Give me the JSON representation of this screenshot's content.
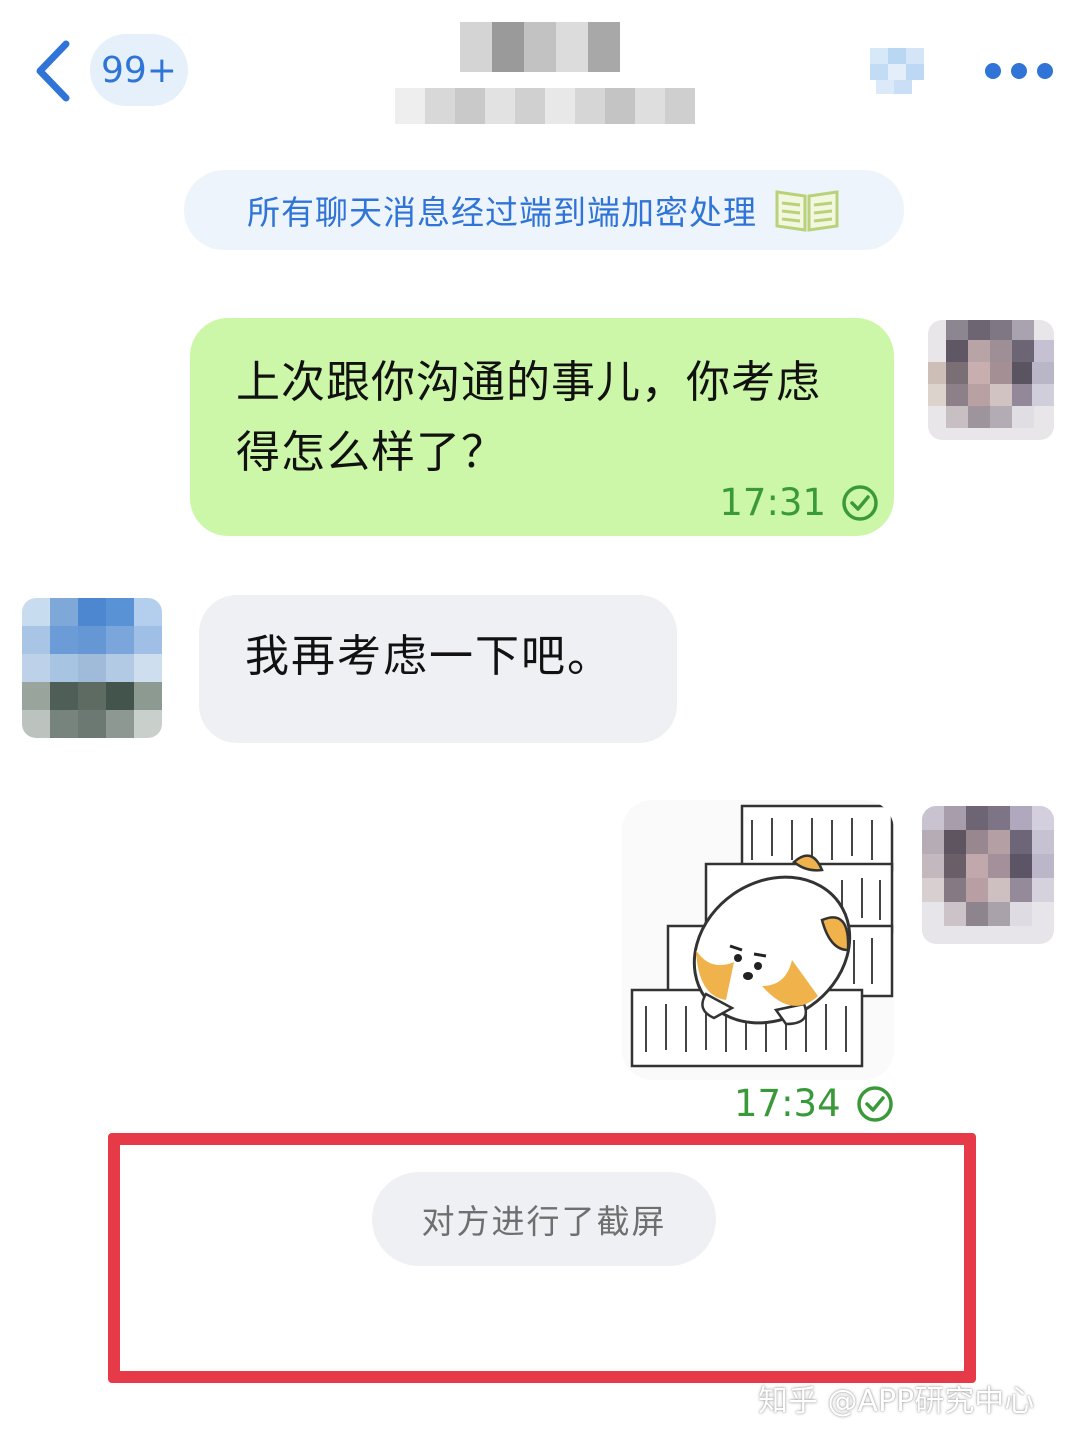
{
  "header": {
    "unread_badge": "99+",
    "back_icon": "chevron-left-icon",
    "call_icon": "phone-icon",
    "more_icon": "more-dots-icon",
    "accent_color": "#2f74d6"
  },
  "notice": {
    "encryption_text": "所有聊天消息经过端到端加密处理",
    "icon": "book-icon"
  },
  "messages": [
    {
      "direction": "outgoing",
      "text": "上次跟你沟通的事儿，你考虑得怎么样了？",
      "time": "17:31",
      "status_icon": "check-circle-icon",
      "bubble_color": "#cdf7a8"
    },
    {
      "direction": "incoming",
      "text": "我再考虑一下吧。",
      "bubble_color": "#eef0f4"
    },
    {
      "direction": "outgoing",
      "type": "sticker",
      "sticker": "shiba-falling-stairs-sticker",
      "time": "17:34",
      "status_icon": "check-circle-icon"
    }
  ],
  "system": {
    "screenshot_notice": "对方进行了截屏",
    "highlight_color": "#e63a49"
  },
  "watermark": "知乎 @APP研究中心"
}
